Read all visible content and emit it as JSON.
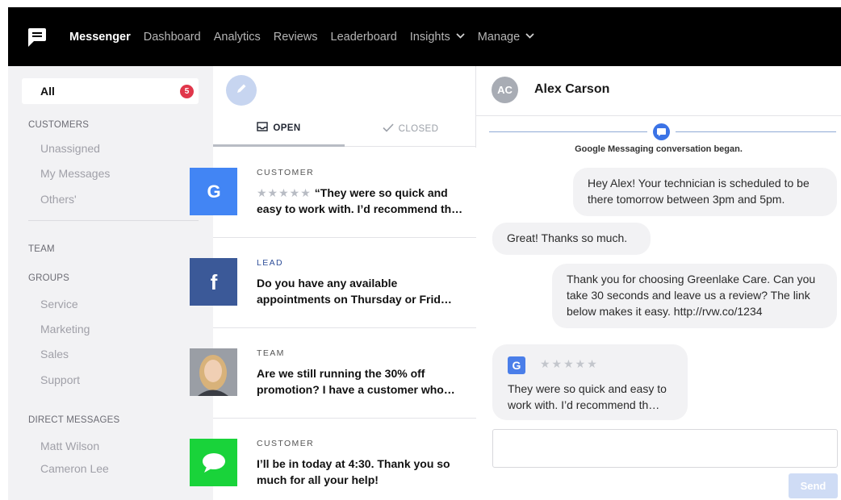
{
  "nav": {
    "items": [
      {
        "label": "Messenger",
        "active": true,
        "dropdown": false
      },
      {
        "label": "Dashboard",
        "active": false,
        "dropdown": false
      },
      {
        "label": "Analytics",
        "active": false,
        "dropdown": false
      },
      {
        "label": "Reviews",
        "active": false,
        "dropdown": false
      },
      {
        "label": "Leaderboard",
        "active": false,
        "dropdown": false
      },
      {
        "label": "Insights",
        "active": false,
        "dropdown": true
      },
      {
        "label": "Manage",
        "active": false,
        "dropdown": true
      }
    ]
  },
  "sidebar": {
    "all_label": "All",
    "all_count": "5",
    "customers_heading": "CUSTOMERS",
    "customers": [
      "Unassigned",
      "My Messages",
      "Others'"
    ],
    "team_heading": "TEAM",
    "groups_heading": "GROUPS",
    "groups": [
      "Service",
      "Marketing",
      "Sales",
      "Support"
    ],
    "dm_heading": "DIRECT MESSAGES",
    "dms": [
      "Matt Wilson",
      "Cameron Lee"
    ]
  },
  "tabs": {
    "open": "OPEN",
    "closed": "CLOSED"
  },
  "conversations": [
    {
      "tag": "CUSTOMER",
      "source": "google",
      "stars": "★★★★★",
      "text": "“They were so quick and easy to work with. I’d recommend th…"
    },
    {
      "tag": "LEAD",
      "source": "facebook",
      "stars": "",
      "text": "Do you have any available appointments on Thursday or Frid…"
    },
    {
      "tag": "TEAM",
      "source": "photo",
      "stars": "",
      "text": "Are we still running the 30% off promotion? I have a customer who…"
    },
    {
      "tag": "CUSTOMER",
      "source": "sms",
      "stars": "",
      "text": "I’ll be in today at 4:30. Thank you so much for all your help!"
    }
  ],
  "chat": {
    "contact_initials": "AC",
    "contact_name": "Alex Carson",
    "system_message": "Google Messaging conversation began.",
    "messages": [
      {
        "direction": "out",
        "text": "Hey Alex! Your technician is scheduled to be there tomorrow between 3pm and 5pm."
      },
      {
        "direction": "in",
        "text": "Great! Thanks so much."
      },
      {
        "direction": "out",
        "text": "Thank you for choosing Greenlake Care. Can you take 30 seconds and leave us a review? The link below makes it easy. http://rvw.co/1234"
      }
    ],
    "review": {
      "badge": "G",
      "stars": "★★★★★",
      "text": "They were so quick and easy to work with. I’d recommend th…"
    },
    "input_placeholder": "",
    "send_label": "Send"
  },
  "colors": {
    "nav_bg": "#000000",
    "badge": "#e0364a",
    "google_blue": "#4285f4",
    "facebook_blue": "#3b5998",
    "sms_green": "#19d33a",
    "accent_blue": "#3b73e6"
  }
}
